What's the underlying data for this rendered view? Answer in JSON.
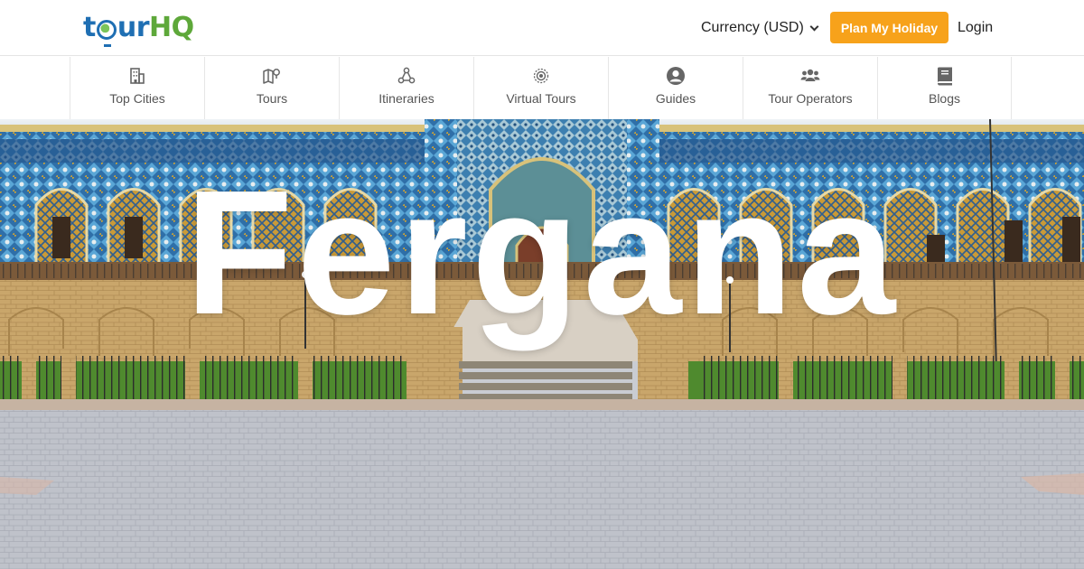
{
  "header": {
    "logo": {
      "part1": "t",
      "part2": "ur",
      "part3": "HQ"
    },
    "currency_label": "Currency (USD)",
    "plan_button": "Plan My Holiday",
    "login": "Login"
  },
  "nav": {
    "items": [
      {
        "label": "Top Cities",
        "icon": "building-icon"
      },
      {
        "label": "Tours",
        "icon": "map-pin-icon"
      },
      {
        "label": "Itineraries",
        "icon": "route-nodes-icon"
      },
      {
        "label": "Virtual Tours",
        "icon": "target-icon"
      },
      {
        "label": "Guides",
        "icon": "user-circle-icon"
      },
      {
        "label": "Tour Operators",
        "icon": "users-group-icon"
      },
      {
        "label": "Blogs",
        "icon": "book-icon"
      }
    ]
  },
  "hero": {
    "title": "Fergana"
  },
  "colors": {
    "brand_blue": "#1f6fb3",
    "brand_green": "#5ea83a",
    "accent_orange": "#f7a21b",
    "tile_blue": "#2f6fa8",
    "brick": "#c9a66b",
    "pavement": "#b9bcc4"
  }
}
